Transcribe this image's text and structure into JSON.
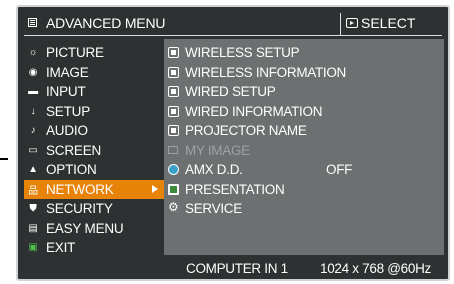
{
  "header": {
    "title": "ADVANCED MENU",
    "title_icon": "menu-icon",
    "select_hint": "SELECT",
    "select_icon": "enter-key-icon"
  },
  "menu": {
    "items": [
      {
        "label": "PICTURE",
        "icon": "sun-icon"
      },
      {
        "label": "IMAGE",
        "icon": "image-icon"
      },
      {
        "label": "INPUT",
        "icon": "input-icon"
      },
      {
        "label": "SETUP",
        "icon": "setup-icon"
      },
      {
        "label": "AUDIO",
        "icon": "note-icon"
      },
      {
        "label": "SCREEN",
        "icon": "screen-icon"
      },
      {
        "label": "OPTION",
        "icon": "option-icon"
      },
      {
        "label": "NETWORK",
        "icon": "network-icon",
        "selected": true
      },
      {
        "label": "SECURITY",
        "icon": "shield-icon"
      },
      {
        "label": "EASY MENU",
        "icon": "easy-menu-icon"
      },
      {
        "label": "EXIT",
        "icon": "exit-icon"
      }
    ],
    "selected_color": "#e8830a"
  },
  "submenu": {
    "items": [
      {
        "label": "WIRELESS SETUP",
        "icon": "wireless-setup-icon",
        "value": ""
      },
      {
        "label": "WIRELESS INFORMATION",
        "icon": "wireless-info-icon",
        "value": ""
      },
      {
        "label": "WIRED SETUP",
        "icon": "wired-setup-icon",
        "value": ""
      },
      {
        "label": "WIRED INFORMATION",
        "icon": "wired-info-icon",
        "value": ""
      },
      {
        "label": "PROJECTOR NAME",
        "icon": "projector-name-icon",
        "value": ""
      },
      {
        "label": "MY IMAGE",
        "icon": "my-image-icon",
        "value": "",
        "disabled": true
      },
      {
        "label": "AMX D.D.",
        "icon": "globe-icon",
        "value": "OFF"
      },
      {
        "label": "PRESENTATION",
        "icon": "presentation-icon",
        "value": ""
      },
      {
        "label": "SERVICE",
        "icon": "service-icon",
        "value": ""
      }
    ]
  },
  "status": {
    "input": "COMPUTER IN 1",
    "resolution": "1024 x 768 @60Hz"
  },
  "colors": {
    "background": "#2e3131",
    "submenu_panel": "#6c7070",
    "accent": "#e8830a"
  }
}
